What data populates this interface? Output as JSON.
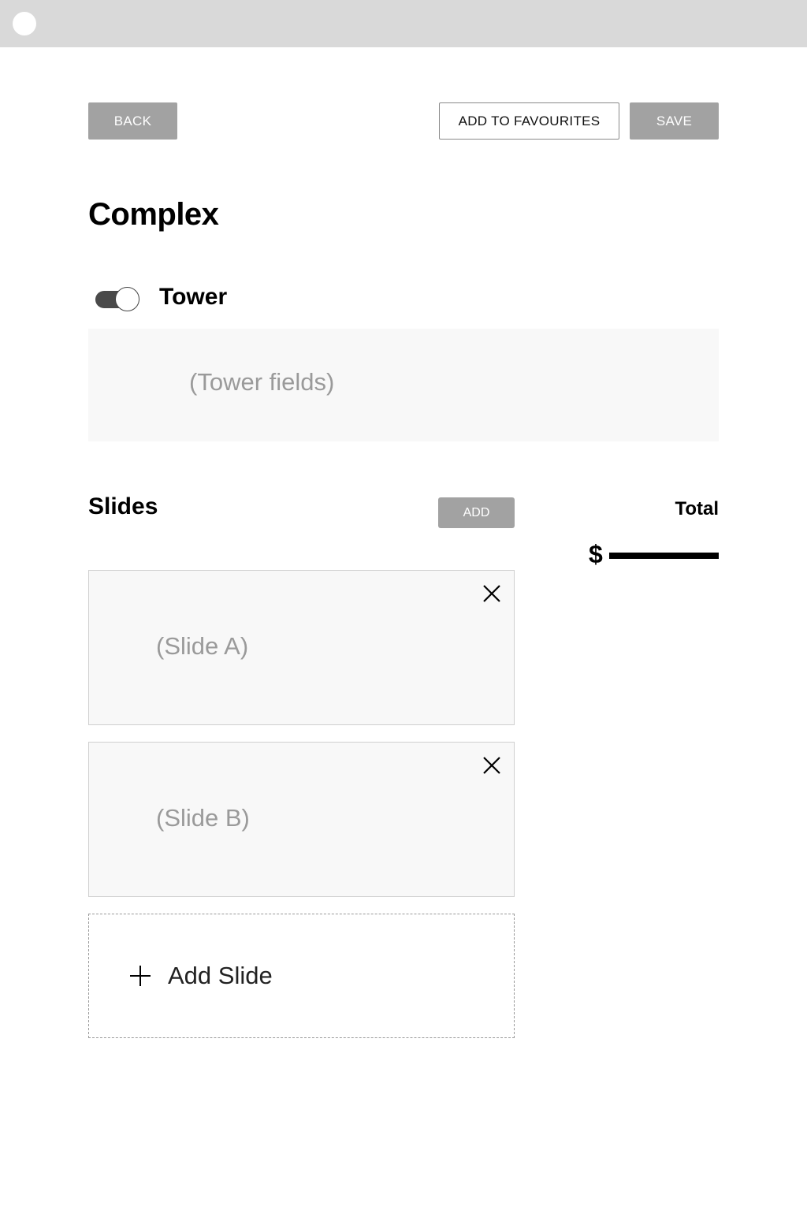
{
  "topbar": {
    "indicator": "circle-indicator"
  },
  "header": {
    "back_label": "BACK",
    "favourites_label": "ADD TO FAVOURITES",
    "save_label": "SAVE"
  },
  "page": {
    "title": "Complex"
  },
  "tower": {
    "toggle_on": true,
    "label": "Tower",
    "placeholder": "(Tower fields)"
  },
  "slides": {
    "title": "Slides",
    "add_label": "ADD",
    "items": [
      {
        "label": "(Slide A)"
      },
      {
        "label": "(Slide B)"
      }
    ],
    "add_slide_label": "Add Slide"
  },
  "total": {
    "label": "Total",
    "currency": "$"
  }
}
